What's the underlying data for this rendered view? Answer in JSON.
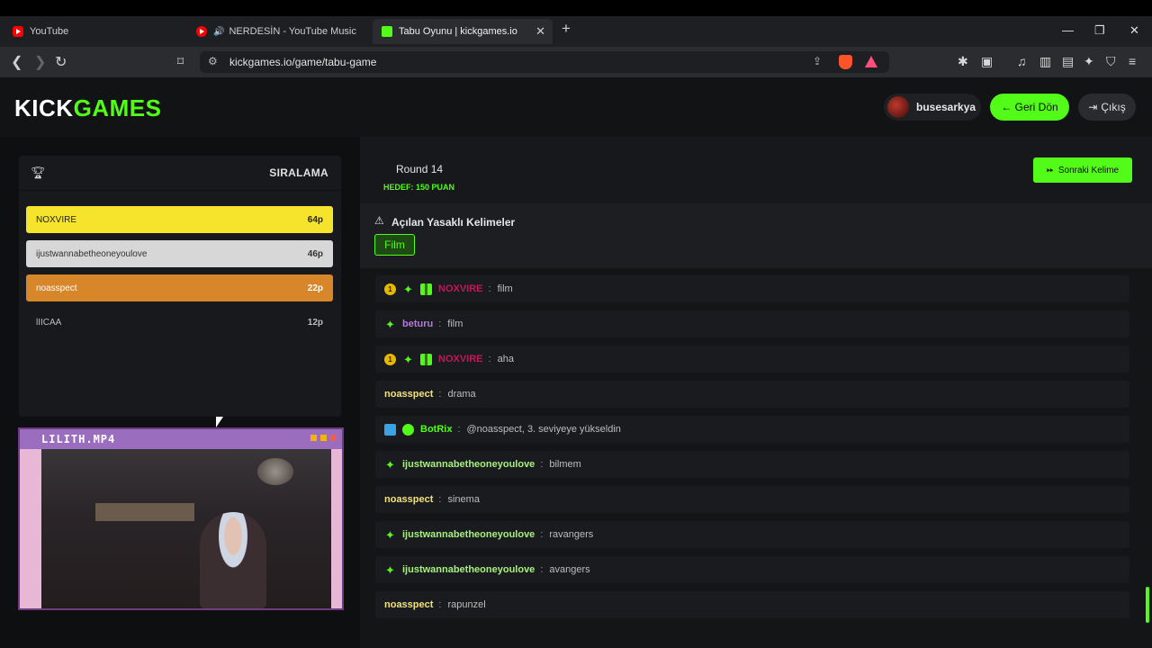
{
  "browser": {
    "tabs": [
      {
        "title": "YouTube",
        "icon": "youtube-icon"
      },
      {
        "title": "NERDESİN - YouTube Music",
        "icon": "youtube-music-icon"
      },
      {
        "title": "Tabu Oyunu | kickgames.io",
        "icon": "kick-icon"
      }
    ],
    "url": "kickgames.io/game/tabu-game"
  },
  "header": {
    "logo_part1": "KICK",
    "logo_part2": "GAMES",
    "username": "busesarkya",
    "back_label": "← Geri Dön",
    "exit_label": "Çıkış"
  },
  "ranking": {
    "title": "SIRALAMA",
    "rows": [
      {
        "name": "NOXVIRE",
        "points": "64p"
      },
      {
        "name": "ijustwannabetheoneyoulove",
        "points": "46p"
      },
      {
        "name": "noasspect",
        "points": "22p"
      },
      {
        "name": "lIICAA",
        "points": "12p"
      }
    ]
  },
  "webcam": {
    "title": "LILITH.MP4"
  },
  "round": {
    "label": "Round 14",
    "target": "HEDEF: 150 PUAN",
    "next_label": "Sonraki Kelime"
  },
  "forbidden": {
    "title": "Açılan Yasaklı Kelimeler",
    "words": [
      "Film"
    ]
  },
  "chat": [
    {
      "user": "NOXVIRE",
      "color": "#c2185b",
      "text": "film",
      "badges": [
        "sub",
        "star",
        "gift"
      ]
    },
    {
      "user": "beturu",
      "color": "#b57ad6",
      "text": "film",
      "badges": [
        "star"
      ]
    },
    {
      "user": "NOXVIRE",
      "color": "#c2185b",
      "text": "aha",
      "badges": [
        "sub",
        "star",
        "gift"
      ]
    },
    {
      "user": "noasspect",
      "color": "#f2e27a",
      "text": "drama",
      "badges": []
    },
    {
      "user": "BotRix",
      "color": "#53fc18",
      "text": "@noasspect, 3. seviyeye yükseldin",
      "badges": [
        "bot",
        "verified"
      ]
    },
    {
      "user": "ijustwannabetheoneyoulove",
      "color": "#a6f07d",
      "text": "bilmem",
      "badges": [
        "star"
      ]
    },
    {
      "user": "noasspect",
      "color": "#f2e27a",
      "text": "sinema",
      "badges": []
    },
    {
      "user": "ijustwannabetheoneyoulove",
      "color": "#a6f07d",
      "text": "ravangers",
      "badges": [
        "star"
      ]
    },
    {
      "user": "ijustwannabetheoneyoulove",
      "color": "#a6f07d",
      "text": "avangers",
      "badges": [
        "star"
      ]
    },
    {
      "user": "noasspect",
      "color": "#f2e27a",
      "text": "rapunzel",
      "badges": []
    }
  ],
  "colors": {
    "accent": "#53fc18"
  }
}
